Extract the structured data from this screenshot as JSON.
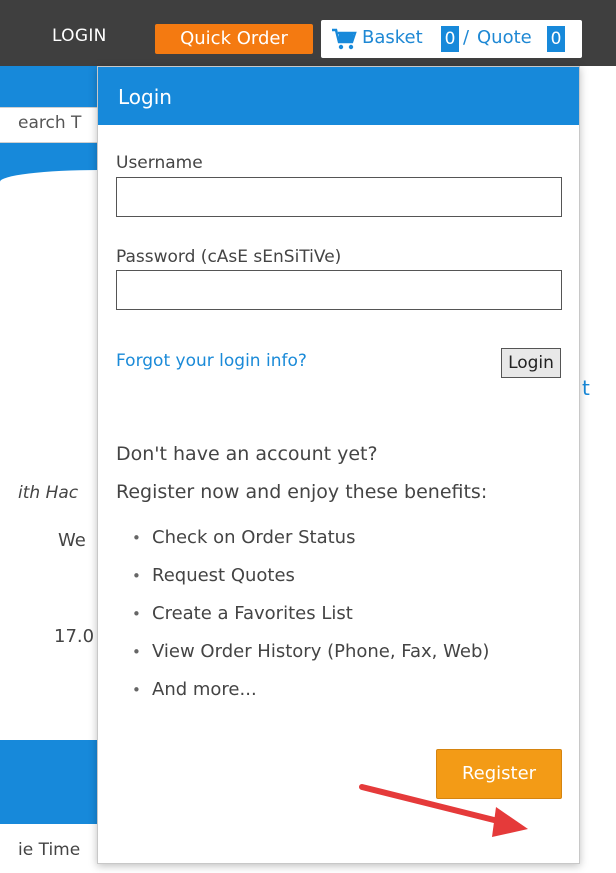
{
  "header": {
    "login_link": "LOGIN",
    "quick_order_label": "Quick Order",
    "basket_label": "Basket",
    "basket_count": "0",
    "separator": "/",
    "quote_label": "Quote",
    "quote_count": "0",
    "cart_icon": "shopping-cart-icon"
  },
  "background_page": {
    "search_fragment": "earch T",
    "text_fragment_1": "ith Hac",
    "text_fragment_2": "We",
    "text_fragment_3": "17.0",
    "text_fragment_4": "t",
    "text_fragment_5": "ie Time"
  },
  "login_dropdown": {
    "title": "Login",
    "username_label": "Username",
    "username_value": "",
    "password_label": "Password (cAsE sEnSiTiVe)",
    "password_value": "",
    "forgot_link": "Forgot your login info?",
    "login_button": "Login",
    "promo_line_1": "Don't have an account yet?",
    "promo_line_2": "Register now and enjoy these benefits:",
    "benefits": [
      "Check on Order Status",
      "Request Quotes",
      "Create a Favorites List",
      "View Order History (Phone, Fax, Web)",
      "And more..."
    ],
    "register_button": "Register"
  },
  "colors": {
    "topbar": "#3f3f3f",
    "accent_blue": "#1789da",
    "quick_order_orange": "#f47a11",
    "register_orange": "#f39b16",
    "annotation_arrow": "#e53a3a"
  }
}
